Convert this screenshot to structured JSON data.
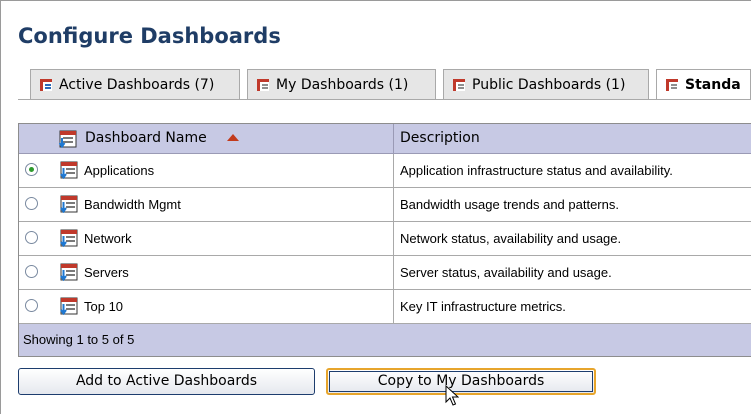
{
  "page": {
    "title": "Configure Dashboards"
  },
  "tabs": [
    {
      "label": "Active Dashboards (7)"
    },
    {
      "label": "My Dashboards (1)"
    },
    {
      "label": "Public Dashboards (1)"
    },
    {
      "label": "Standa",
      "active": true
    }
  ],
  "table": {
    "headers": {
      "name": "Dashboard Name",
      "description": "Description"
    },
    "rows": [
      {
        "name": "Applications",
        "description": "Application infrastructure status and availability.",
        "selected": true
      },
      {
        "name": "Bandwidth Mgmt",
        "description": "Bandwidth usage trends and patterns.",
        "selected": false
      },
      {
        "name": "Network",
        "description": "Network status, availability and usage.",
        "selected": false
      },
      {
        "name": "Servers",
        "description": "Server status, availability and usage.",
        "selected": false
      },
      {
        "name": "Top 10",
        "description": "Key IT infrastructure metrics.",
        "selected": false
      }
    ],
    "footer": "Showing 1 to 5 of 5"
  },
  "buttons": {
    "add": "Add to Active Dashboards",
    "copy": "Copy to My Dashboards"
  },
  "icons": {
    "tab": "dashboard-tab-icon",
    "row": "dashboard-icon",
    "sort": "sort-ascending-icon"
  },
  "colors": {
    "title": "#1f3d66",
    "header_bg": "#c7c9e4",
    "selected_button_border": "#e7a52c"
  }
}
